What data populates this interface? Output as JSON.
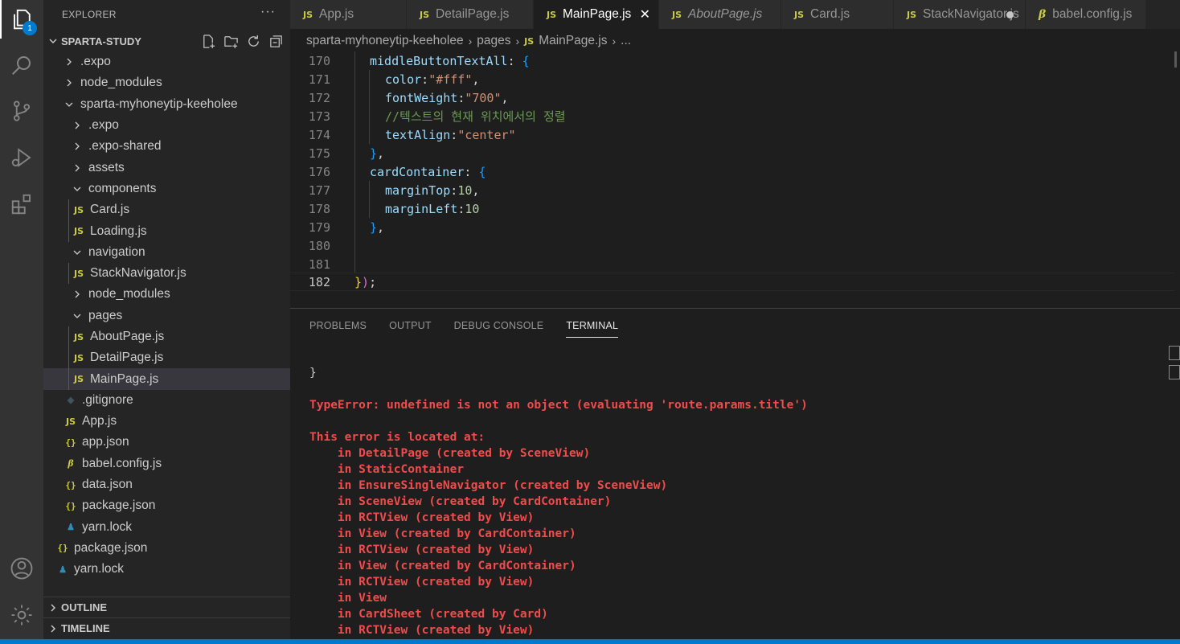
{
  "activity_bar": {
    "explorer_badge": "1"
  },
  "explorer": {
    "title": "EXPLORER",
    "more": "···",
    "workspace": "SPARTA-STUDY",
    "tree": [
      {
        "label": ".expo",
        "type": "folder",
        "expanded": false
      },
      {
        "label": "node_modules",
        "type": "folder",
        "expanded": false
      },
      {
        "label": "sparta-myhoneytip-keeholee",
        "type": "folder",
        "expanded": true
      },
      {
        "label": ".expo",
        "type": "folder",
        "expanded": false
      },
      {
        "label": ".expo-shared",
        "type": "folder",
        "expanded": false
      },
      {
        "label": "assets",
        "type": "folder",
        "expanded": false
      },
      {
        "label": "components",
        "type": "folder",
        "expanded": true
      },
      {
        "label": "Card.js",
        "type": "js"
      },
      {
        "label": "Loading.js",
        "type": "js"
      },
      {
        "label": "navigation",
        "type": "folder",
        "expanded": true
      },
      {
        "label": "StackNavigator.js",
        "type": "js"
      },
      {
        "label": "node_modules",
        "type": "folder",
        "expanded": false
      },
      {
        "label": "pages",
        "type": "folder",
        "expanded": true
      },
      {
        "label": "AboutPage.js",
        "type": "js"
      },
      {
        "label": "DetailPage.js",
        "type": "js"
      },
      {
        "label": "MainPage.js",
        "type": "js"
      },
      {
        "label": ".gitignore",
        "type": "git"
      },
      {
        "label": "App.js",
        "type": "js"
      },
      {
        "label": "app.json",
        "type": "json"
      },
      {
        "label": "babel.config.js",
        "type": "babel"
      },
      {
        "label": "data.json",
        "type": "json"
      },
      {
        "label": "package.json",
        "type": "json"
      },
      {
        "label": "yarn.lock",
        "type": "yarn"
      },
      {
        "label": "package.json",
        "type": "json"
      },
      {
        "label": "yarn.lock",
        "type": "yarn"
      }
    ],
    "outline": "OUTLINE",
    "timeline": "TIMELINE"
  },
  "icons": {
    "js": "JS",
    "json": "{}",
    "babel": "β",
    "yarn": "♟",
    "git": "◆"
  },
  "tabs": [
    {
      "label": "App.js",
      "icon": "JS"
    },
    {
      "label": "DetailPage.js",
      "icon": "JS"
    },
    {
      "label": "MainPage.js",
      "icon": "JS",
      "active": true
    },
    {
      "label": "AboutPage.js",
      "icon": "JS",
      "italic": true
    },
    {
      "label": "Card.js",
      "icon": "JS"
    },
    {
      "label": "StackNavigator.js",
      "icon": "JS",
      "modified": true
    },
    {
      "label": "babel.config.js",
      "icon": "β"
    }
  ],
  "breadcrumb": {
    "project": "sparta-myhoneytip-keeholee",
    "folder": "pages",
    "file_icon": "JS",
    "file": "MainPage.js",
    "more": "..."
  },
  "editor": {
    "line_numbers": [
      "170",
      "171",
      "172",
      "173",
      "174",
      "175",
      "176",
      "177",
      "178",
      "179",
      "180",
      "181",
      "182"
    ],
    "l170_key": "middleButtonTextAll",
    "l171_key": "color",
    "l171_val": "\"#fff\"",
    "l172_key": "fontWeight",
    "l172_val": "\"700\"",
    "l173_comment": "//텍스트의 현재 위치에서의 정렬",
    "l174_key": "textAlign",
    "l174_val": "\"center\"",
    "l176_key": "cardContainer",
    "l177_key": "marginTop",
    "l177_val": "10",
    "l178_key": "marginLeft",
    "l178_val": "10"
  },
  "panel": {
    "tabs": [
      "PROBLEMS",
      "OUTPUT",
      "DEBUG CONSOLE",
      "TERMINAL"
    ],
    "terminal_lines": [
      {
        "text": "}",
        "kind": "plain"
      },
      {
        "text": "",
        "kind": "plain"
      },
      {
        "text": "TypeError: undefined is not an object (evaluating 'route.params.title')",
        "kind": "err"
      },
      {
        "text": "",
        "kind": "plain"
      },
      {
        "text": "This error is located at:",
        "kind": "err"
      },
      {
        "text": "    in DetailPage (created by SceneView)",
        "kind": "err"
      },
      {
        "text": "    in StaticContainer",
        "kind": "err"
      },
      {
        "text": "    in EnsureSingleNavigator (created by SceneView)",
        "kind": "err"
      },
      {
        "text": "    in SceneView (created by CardContainer)",
        "kind": "err"
      },
      {
        "text": "    in RCTView (created by View)",
        "kind": "err"
      },
      {
        "text": "    in View (created by CardContainer)",
        "kind": "err"
      },
      {
        "text": "    in RCTView (created by View)",
        "kind": "err"
      },
      {
        "text": "    in View (created by CardContainer)",
        "kind": "err"
      },
      {
        "text": "    in RCTView (created by View)",
        "kind": "err"
      },
      {
        "text": "    in View",
        "kind": "err"
      },
      {
        "text": "    in CardSheet (created by Card)",
        "kind": "err"
      },
      {
        "text": "    in RCTView (created by View)",
        "kind": "err"
      }
    ]
  },
  "colors": {
    "accent": "#007acc",
    "error": "#f14c4c",
    "js_icon": "#cbcb41"
  }
}
